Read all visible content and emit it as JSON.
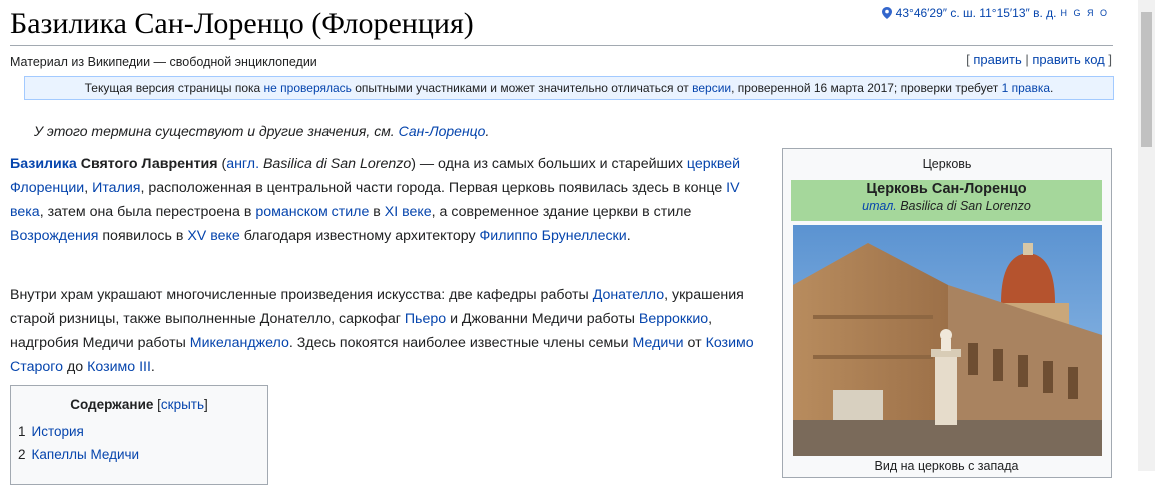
{
  "page": {
    "title": "Базилика Сан-Лоренцо (Флоренция)",
    "coordinates": "43°46′29″ с. ш. 11°15′13″ в. д.",
    "coord_links": "H G Я O",
    "from_wikipedia": "Материал из Википедии — свободной энциклопедии",
    "edit": {
      "open": "[ ",
      "edit_label": "править",
      "sep": " | ",
      "edit_code_label": "править код",
      "close": " ]"
    }
  },
  "notice": {
    "t1": "Текущая версия страницы пока ",
    "l1": "не проверялась",
    "t2": " опытными участниками и может значительно отличаться от ",
    "l2": "версии",
    "t3": ", проверенной 16 марта 2017; проверки требует ",
    "l3": "1 правка",
    "t4": "."
  },
  "hatnote": {
    "text": "У этого термина существуют и другие значения, см. ",
    "link": "Сан-Лоренцо",
    "end": "."
  },
  "para1": [
    {
      "t": "Базилика",
      "link": true,
      "bold": true
    },
    {
      "t": " Святого Лаврентия",
      "bold": true
    },
    {
      "t": " ("
    },
    {
      "t": "англ.",
      "link": true
    },
    {
      "t": " Basilica di San Lorenzo",
      "italic": true
    },
    {
      "t": ") — одна из самых больших и старейших "
    },
    {
      "t": "церквей Флоренции",
      "link": true
    },
    {
      "t": ", "
    },
    {
      "t": "Италия",
      "link": true
    },
    {
      "t": ", расположенная в центральной части города. Первая церковь появилась здесь в конце "
    },
    {
      "t": "IV века",
      "link": true
    },
    {
      "t": ", затем она была перестроена в "
    },
    {
      "t": "романском стиле",
      "link": true
    },
    {
      "t": " в "
    },
    {
      "t": "XI веке",
      "link": true
    },
    {
      "t": ", а современное здание церкви в стиле "
    },
    {
      "t": "Возрождения",
      "link": true
    },
    {
      "t": " появилось в "
    },
    {
      "t": "XV веке",
      "link": true
    },
    {
      "t": " благодаря известному архитектору "
    },
    {
      "t": "Филиппо Брунеллески",
      "link": true
    },
    {
      "t": "."
    }
  ],
  "para2": [
    {
      "t": "Внутри храм украшают многочисленные произведения искусства: две кафедры работы "
    },
    {
      "t": "Донателло",
      "link": true
    },
    {
      "t": ", украшения старой ризницы, также выполненные Донателло, саркофаг "
    },
    {
      "t": "Пьеро",
      "link": true
    },
    {
      "t": " и Джованни Медичи работы "
    },
    {
      "t": "Верроккио",
      "link": true
    },
    {
      "t": ", надгробия Медичи работы "
    },
    {
      "t": "Микеланджело",
      "link": true
    },
    {
      "t": ". Здесь покоятся наиболее известные члены семьи "
    },
    {
      "t": "Медичи",
      "link": true
    },
    {
      "t": " от "
    },
    {
      "t": "Козимо Старого",
      "link": true
    },
    {
      "t": " до "
    },
    {
      "t": "Козимо III",
      "link": true
    },
    {
      "t": "."
    }
  ],
  "toc": {
    "title": "Содержание",
    "hide_open": " [",
    "hide": "скрыть",
    "hide_close": "]",
    "items": [
      {
        "num": "1",
        "label": "История"
      },
      {
        "num": "2",
        "label": "Капеллы Медичи"
      }
    ]
  },
  "infobox": {
    "type": "Церковь",
    "name": "Церковь Сан-Лоренцо",
    "lang": "итал.",
    "orig_name": " Basilica di San Lorenzo",
    "caption": "Вид на церковь с запада"
  },
  "colors": {
    "link": "#0645ad",
    "infobox_header": "#a5d79b",
    "notice_bg": "#eaf3ff",
    "notice_border": "#a3caff"
  }
}
